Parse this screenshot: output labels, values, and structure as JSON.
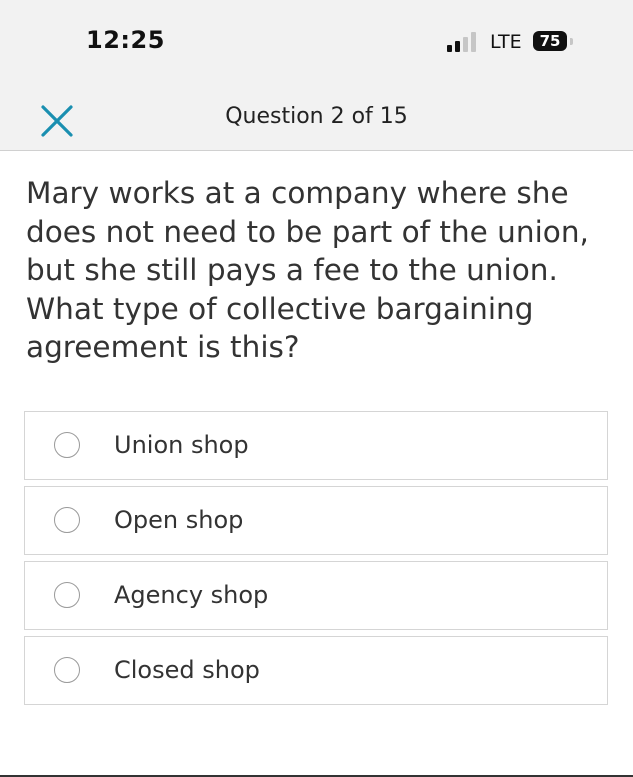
{
  "status_bar": {
    "time": "12:25",
    "network": "LTE",
    "battery": "75"
  },
  "header": {
    "title": "Question 2 of 15",
    "close_icon": "close-x-icon",
    "accent_color": "#1a8fb0"
  },
  "question": {
    "text": "Mary works at a company where she does not need to be part of the union, but she still pays a fee to the union. What type of collective bargaining agreement is this?"
  },
  "options": [
    {
      "label": "Union shop"
    },
    {
      "label": "Open shop"
    },
    {
      "label": "Agency shop"
    },
    {
      "label": "Closed shop"
    }
  ]
}
